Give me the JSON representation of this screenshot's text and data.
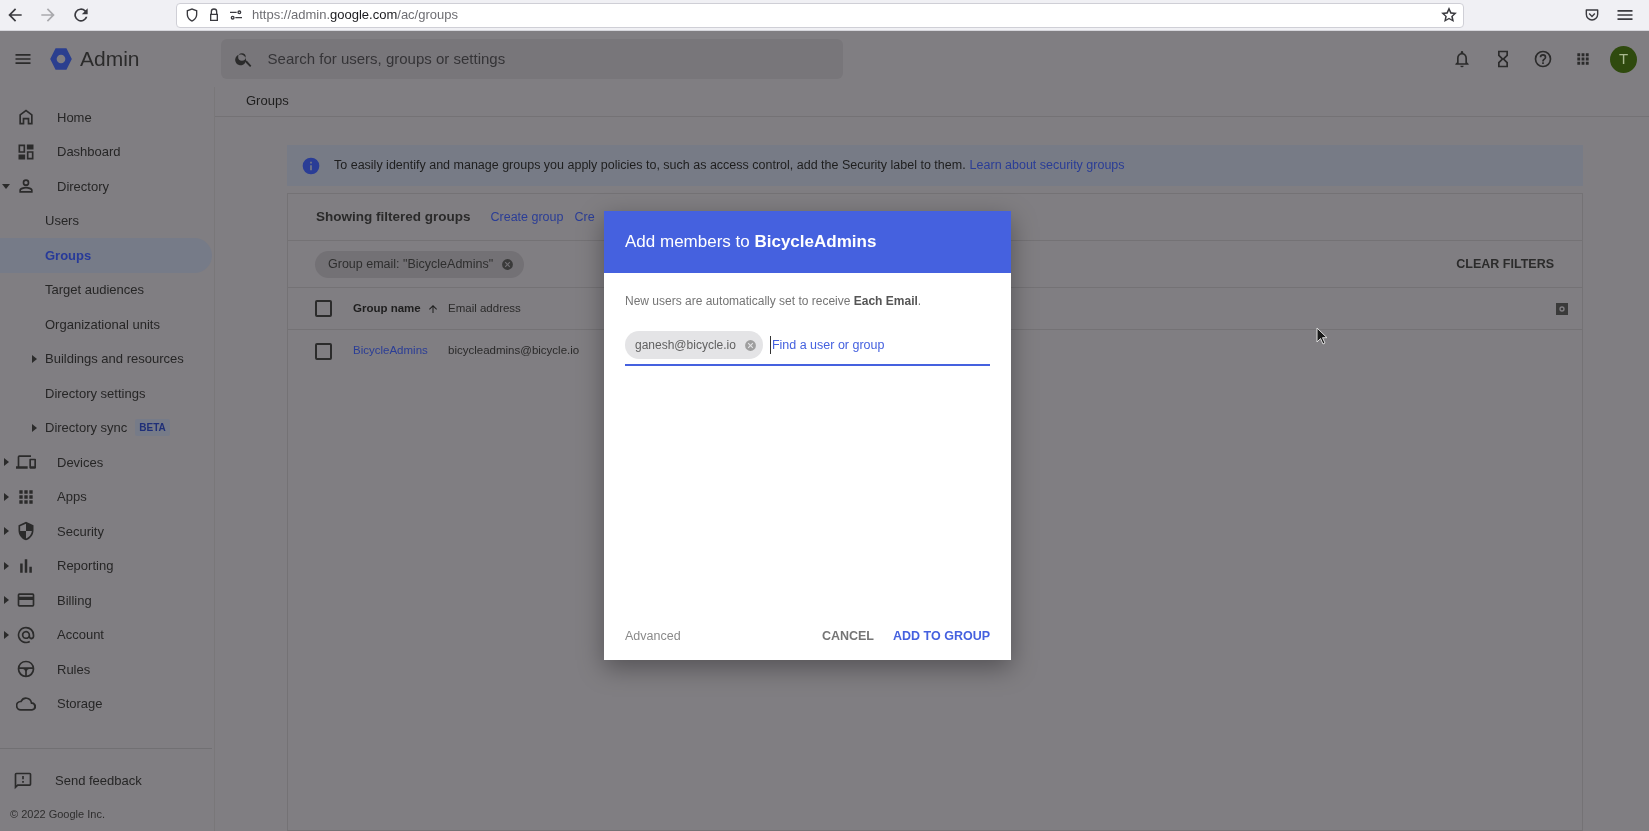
{
  "browser": {
    "url": "https://admin.**google.com**/ac/groups"
  },
  "header": {
    "app_name": "Admin",
    "search": {
      "placeholder": "Search for users, groups or settings"
    },
    "avatar": "T"
  },
  "breadcrumb": "Groups",
  "sidebar": {
    "items": [
      {
        "label": "Home",
        "kind": "link",
        "selected": false
      },
      {
        "label": "Dashboard",
        "kind": "link",
        "selected": false
      },
      {
        "label": "Directory",
        "kind": "section",
        "expanded": true,
        "selected": false,
        "children": [
          {
            "label": "Users",
            "kind": "link",
            "selected": false
          },
          {
            "label": "Groups",
            "kind": "link",
            "selected": true
          },
          {
            "label": "Target audiences",
            "kind": "link",
            "selected": false
          },
          {
            "label": "Organizational units",
            "kind": "link",
            "selected": false
          },
          {
            "label": "Buildings and resources",
            "kind": "section",
            "expanded": false,
            "selected": false
          },
          {
            "label": "Directory settings",
            "kind": "link",
            "selected": false
          },
          {
            "label": "Directory sync",
            "kind": "section",
            "expanded": false,
            "selected": false,
            "badge": "BETA"
          }
        ]
      },
      {
        "label": "Devices",
        "kind": "section",
        "expanded": false,
        "selected": false
      },
      {
        "label": "Apps",
        "kind": "section",
        "expanded": false,
        "selected": false
      },
      {
        "label": "Security",
        "kind": "section",
        "expanded": false,
        "selected": false
      },
      {
        "label": "Reporting",
        "kind": "section",
        "expanded": false,
        "selected": false
      },
      {
        "label": "Billing",
        "kind": "section",
        "expanded": false,
        "selected": false
      },
      {
        "label": "Account",
        "kind": "section",
        "expanded": false,
        "selected": false
      },
      {
        "label": "Rules",
        "kind": "link",
        "selected": false
      },
      {
        "label": "Storage",
        "kind": "link",
        "selected": false
      }
    ],
    "feedback": "Send feedback",
    "copyright": "© 2022 Google Inc."
  },
  "banner": {
    "text": "To easily identify and manage groups you apply policies to, such as access control, add the Security label to them.",
    "link": "Learn about security groups"
  },
  "groups_card": {
    "title": "Showing filtered groups",
    "actions": [
      "Create group",
      "Cre"
    ],
    "filter_chip": "Group email: \"BicycleAdmins\"",
    "clear_filters": "CLEAR FILTERS",
    "select_all": {
      "checked": false
    },
    "columns": [
      {
        "label": "Group name",
        "sorted": true
      },
      {
        "label": "Email address",
        "sorted": false
      }
    ],
    "rows": [
      {
        "checked": false,
        "name": "BicycleAdmins",
        "email": "bicycleadmins@bicycle.io"
      }
    ]
  },
  "dialog": {
    "title": "Add members to **BicycleAdmins**",
    "note": "New users are automatically set to receive **Each Email**.",
    "chips": [
      "ganesh@bicycle.io"
    ],
    "placeholder": "Find a user or group",
    "advanced": "Advanced",
    "buttons": [
      {
        "label": "CANCEL",
        "primary": false
      },
      {
        "label": "ADD TO GROUP",
        "primary": true
      }
    ]
  }
}
